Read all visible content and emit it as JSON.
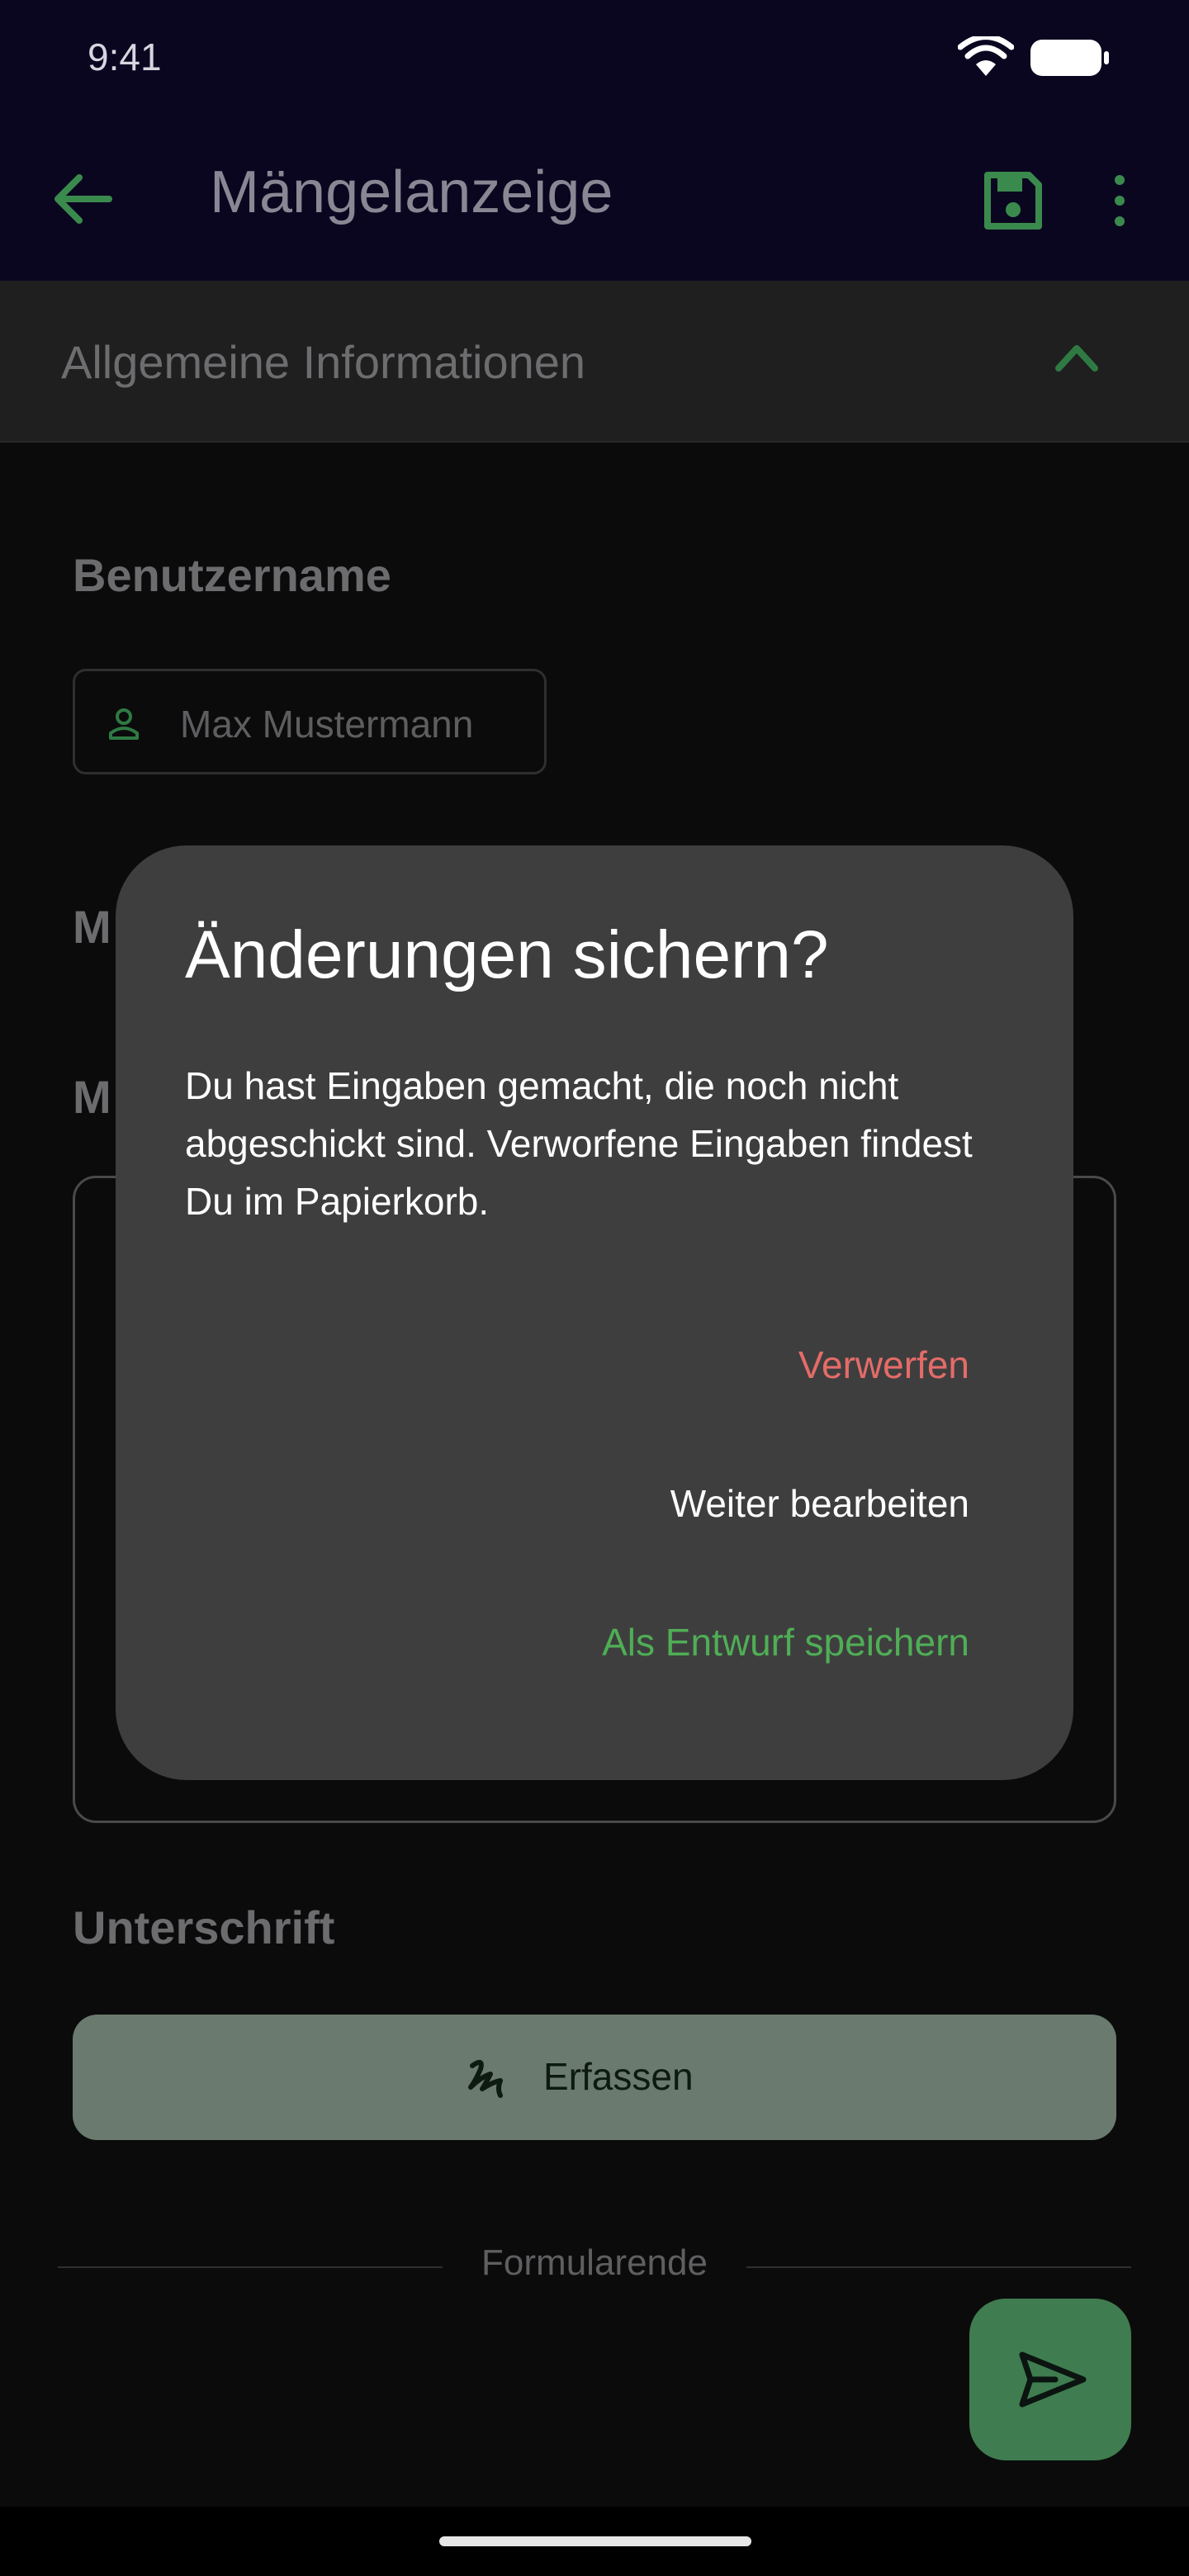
{
  "status_bar": {
    "time": "9:41"
  },
  "app_bar": {
    "title": "Mängelanzeige"
  },
  "section": {
    "title": "Allgemeine Informationen"
  },
  "form": {
    "username_label": "Benutzername",
    "username_value": "Max Mustermann",
    "field_2_label_partial": "M",
    "field_3_label_partial": "M",
    "signature_label": "Unterschrift",
    "capture_button": "Erfassen",
    "form_end": "Formularende"
  },
  "dialog": {
    "title": "Änderungen sichern?",
    "body": "Du hast Eingaben gemacht, die noch nicht abgeschickt sind. Verworfene Eingaben findest Du im Papierkorb.",
    "actions": {
      "discard": "Verwerfen",
      "continue": "Weiter bearbeiten",
      "save_draft": "Als Entwurf speichern"
    }
  },
  "colors": {
    "accent_green": "#4fae55",
    "danger_red": "#e46c68",
    "dialog_bg": "#3e3e3f",
    "app_bar_bg": "#0b0620"
  },
  "icons": [
    "back-arrow-icon",
    "save-icon",
    "more-vert-icon",
    "chevron-up-icon",
    "person-icon",
    "signature-icon",
    "send-icon",
    "wifi-icon",
    "battery-icon"
  ]
}
